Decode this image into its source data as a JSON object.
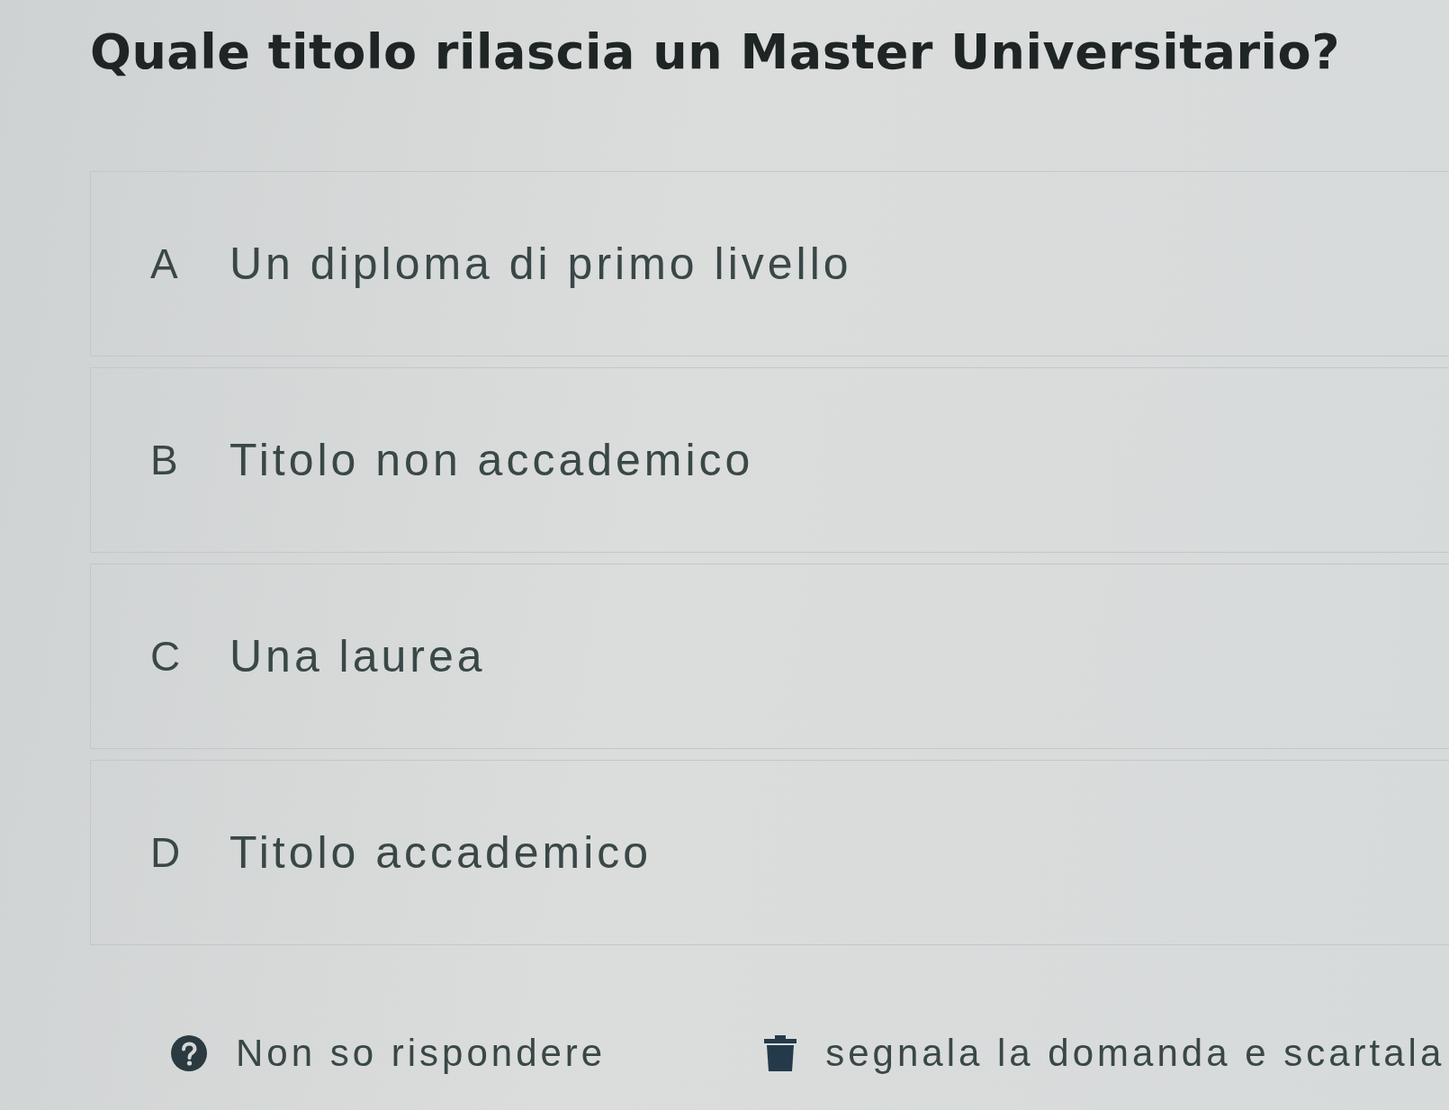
{
  "question": {
    "title": "Quale titolo rilascia un Master Universitario?"
  },
  "options": [
    {
      "letter": "A",
      "text": "Un diploma di primo livello",
      "selected": false
    },
    {
      "letter": "B",
      "text": "Titolo non accademico",
      "selected": false
    },
    {
      "letter": "C",
      "text": "Una laurea",
      "selected": false
    },
    {
      "letter": "D",
      "text": "Titolo accademico",
      "selected": false
    }
  ],
  "actions": [
    {
      "kind": "dont-know",
      "label": "Non so rispondere"
    },
    {
      "kind": "report",
      "label": "segnala la domanda e scartala"
    }
  ]
}
